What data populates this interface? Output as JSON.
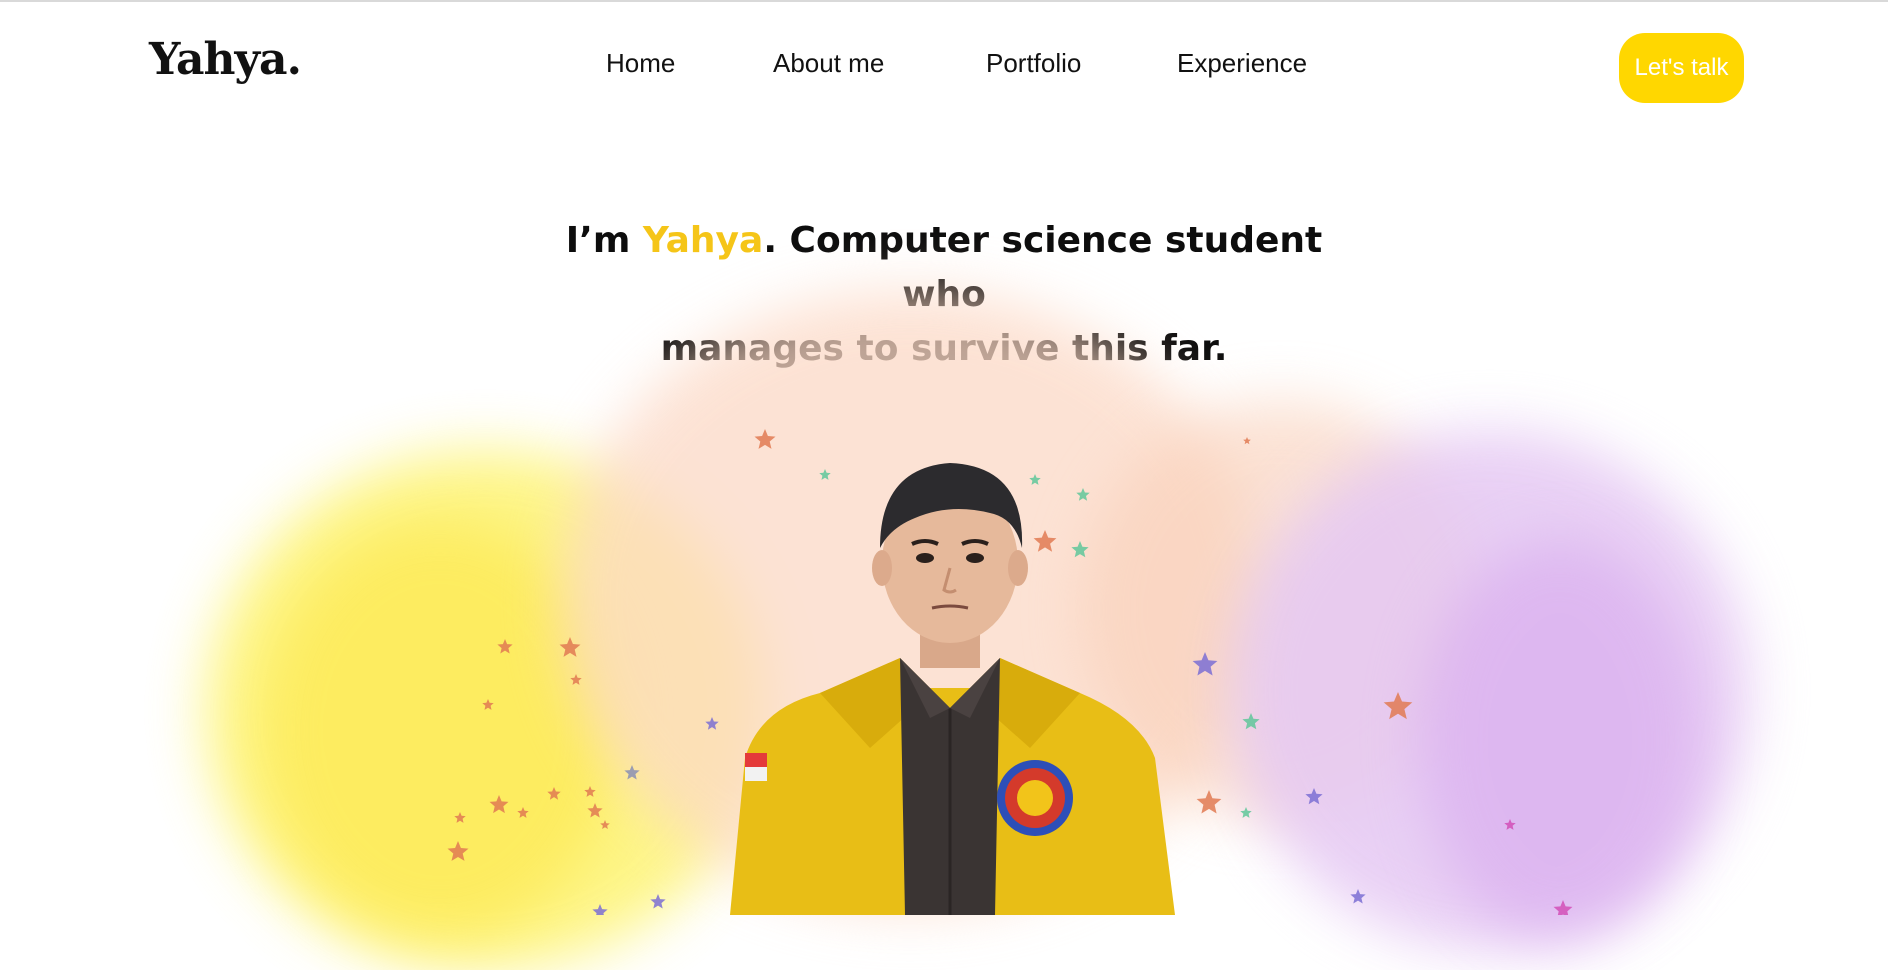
{
  "header": {
    "logo": "Yahya.",
    "nav": [
      {
        "label": "Home"
      },
      {
        "label": "About me"
      },
      {
        "label": "Portfolio"
      },
      {
        "label": "Experience"
      }
    ],
    "cta_label": "Let's talk"
  },
  "hero": {
    "headline_prefix": "I’m ",
    "headline_name": "Yahya",
    "headline_rest_line1": ". Computer science student who",
    "headline_line2": "manages to survive this far."
  },
  "colors": {
    "accent": "#FFD700",
    "name_highlight": "#F5C518",
    "text": "#111111",
    "jacket": "#E8BE16",
    "shirt": "#3a3433"
  },
  "icons": [
    "star-icon"
  ]
}
